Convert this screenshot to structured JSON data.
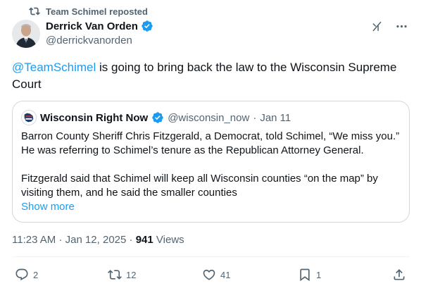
{
  "repost": {
    "text": "Team Schimel reposted"
  },
  "author": {
    "name": "Derrick Van Orden",
    "handle": "@derrickvanorden"
  },
  "tweet": {
    "mention": "@TeamSchimel",
    "text": " is going to bring back the law to the Wisconsin Supreme Court"
  },
  "quote": {
    "name": "Wisconsin Right Now",
    "handle": "@wisconsin_now",
    "separator": "·",
    "date": "Jan 11",
    "para1": "Barron County Sheriff Chris Fitzgerald, a Democrat, told Schimel, “We miss you.” He was referring to Schimel’s tenure as the Republican Attorney General.",
    "para2": "Fitzgerald said that Schimel will keep all Wisconsin counties “on the map” by visiting them, and he said the smaller counties",
    "show_more": "Show more"
  },
  "meta": {
    "time": "11:23 AM",
    "separator": "·",
    "date": "Jan 12, 2025",
    "separator2": "·",
    "views_count": "941",
    "views_label": "Views"
  },
  "actions": {
    "replies": "2",
    "reposts": "12",
    "likes": "41",
    "bookmarks": "1"
  },
  "colors": {
    "accent": "#1d9bf0",
    "muted": "#536471",
    "text": "#0f1419",
    "border": "#cfd9de"
  },
  "icons": [
    "repost-icon",
    "verified-badge-icon",
    "grok-icon",
    "more-icon",
    "reply-icon",
    "like-icon",
    "bookmark-icon",
    "share-icon"
  ]
}
